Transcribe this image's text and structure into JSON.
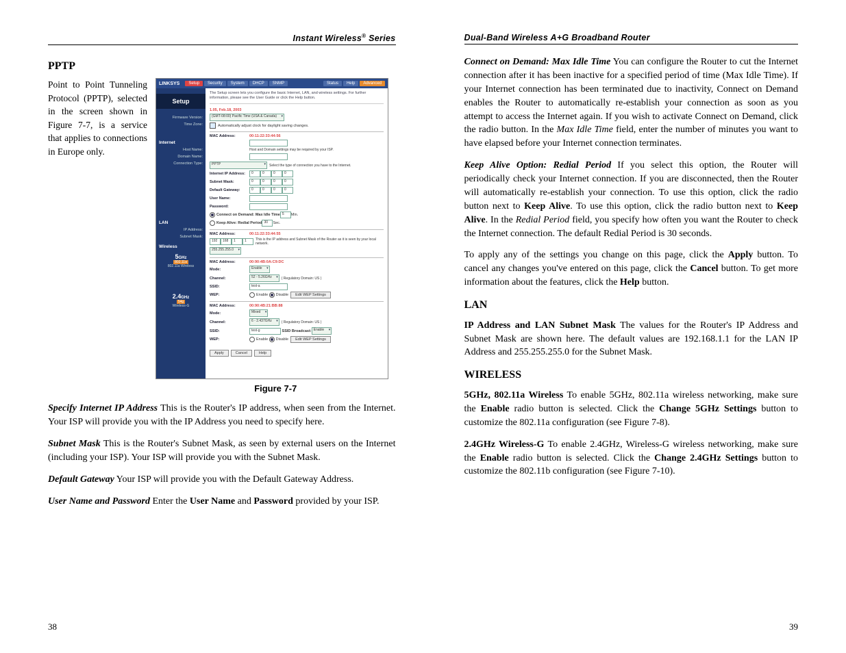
{
  "left": {
    "header": "Instant Wireless® Series",
    "section_title": "PPTP",
    "intro": "Point to Point Tunneling Protocol (PPTP), selected in the screen shown in Figure 7-7, is a service that applies to connections in Europe only.",
    "figure_caption": "Figure 7-7",
    "para_specify_label": "Specify Internet IP Address",
    "para_specify": "  This is the Router's IP address, when seen from the Internet. Your ISP will provide you with the IP Address you need to specify here.",
    "para_subnet_label": "Subnet Mask",
    "para_subnet": "  This is the Router's Subnet Mask, as seen by external users on the Internet (including your ISP). Your ISP will provide you with the Subnet Mask.",
    "para_gateway_label": "Default Gateway",
    "para_gateway": "  Your ISP will provide you with the Default Gateway Address.",
    "para_userpass_label": "User Name and Password",
    "para_userpass_a": "  Enter the ",
    "para_userpass_b": "User Name",
    "para_userpass_c": " and ",
    "para_userpass_d": "Password",
    "para_userpass_e": " provided by your ISP.",
    "page_num": "38"
  },
  "right": {
    "header": "Dual-Band Wireless A+G Broadband Router",
    "p1_label": "Connect on Demand: Max Idle Time",
    "p1_a": "  You can configure the Router to cut the Internet connection after it has been inactive for a specified period of time (Max Idle Time). If your Internet connection has been terminated due to inactivity, Connect on Demand enables the Router to automatically re-establish your connection as soon as you attempt to access the Internet again. If you wish to activate Connect on Demand, click the radio button. In the ",
    "p1_b": "Max Idle Time",
    "p1_c": " field, enter the number of minutes you want to have elapsed before your Internet connection terminates.",
    "p2_label": "Keep Alive Option: Redial Period",
    "p2_a": " If you select this option, the Router will periodically check your Internet connection. If you are disconnected, then the Router will automatically re-establish your connection. To use this option, click the radio button next to ",
    "p2_b": "Keep Alive",
    "p2_c": ". To use this option, click the radio button next to ",
    "p2_d": "Keep Alive",
    "p2_e": ". In the ",
    "p2_f": "Redial Period",
    "p2_g": " field, you specify how often you want the Router to check the Internet connection. The default Redial Period is 30 seconds.",
    "p3_a": "To apply any of the settings you change on this page, click the ",
    "p3_b": "Apply",
    "p3_c": " button. To cancel any changes you've entered on this page, click the ",
    "p3_d": "Cancel",
    "p3_e": " button. To get more information about the features, click the ",
    "p3_f": "Help",
    "p3_g": " button.",
    "lan_title": "LAN",
    "lan_label": "IP Address and LAN Subnet Mask",
    "lan_text": "  The values for the Router's IP Address and Subnet Mask are shown here. The default values are 192.168.1.1 for the LAN IP Address and 255.255.255.0 for the Subnet Mask.",
    "wireless_title": "WIRELESS",
    "w5_label": "5GHz, 802.11a Wireless",
    "w5_a": "  To enable 5GHz, 802.11a wireless networking, make sure the ",
    "w5_b": "Enable",
    "w5_c": " radio button is selected. Click the ",
    "w5_d": "Change 5GHz Settings",
    "w5_e": " button to customize the 802.11a configuration (see Figure 7-8).",
    "w24_label": "2.4GHz Wireless-G",
    "w24_a": "  To enable 2.4GHz, Wireless-G wireless networking, make sure the ",
    "w24_b": "Enable",
    "w24_c": " radio button is selected. Click the ",
    "w24_d": "Change 2.4GHz Settings",
    "w24_e": " button to customize the 802.11b configuration (see Figure 7-10).",
    "page_num": "39"
  },
  "router": {
    "logo": "LINKSYS",
    "tabs": [
      "Setup",
      "Security",
      "System",
      "DHCP",
      "SNMP"
    ],
    "right_tabs": [
      "Status",
      "Help",
      "Advanced"
    ],
    "setup": "Setup",
    "desc": "The Setup screen lets you configure the basic Internet, LAN, and wireless settings. For further information, please see the User Guide or click the Help button.",
    "fw_label": "Firmware Version:",
    "fw_val": "1.05, Feb.18, 2003",
    "tz_label": "Time Zone:",
    "tz_val": "(GMT-08:00) Pacific Time (USA & Canada)",
    "tz_auto": "Automatically adjust clock for daylight saving changes.",
    "internet_title": "Internet",
    "mac1_label": "MAC Address:",
    "mac1_val": "00:11:22:33:44:56",
    "host_label": "Host Name:",
    "domain_label": "Domain Name:",
    "hostnote": "Host and Domain settings may be required by your ISP.",
    "conn_label": "Connection Type:",
    "conn_val": "PPTP",
    "conn_note": "Select the type of connection you have to the Internet.",
    "iip_label": "Internet IP Address:",
    "sm_label": "Subnet Mask:",
    "dg_label": "Default Gateway:",
    "un_label": "User Name:",
    "pw_label": "Password:",
    "cod": "Connect on Demand: Max Idle Time",
    "cod_val": "5",
    "cod_unit": "Min.",
    "ka": "Keep Alive: Redial Period",
    "ka_val": "30",
    "ka_unit": "Sec.",
    "lan_title": "LAN",
    "mac2_label": "MAC Address:",
    "mac2_val": "00:11:22:33:44:55",
    "lanip_label": "IP Address:",
    "lanip": [
      "192",
      "168",
      "1",
      "1"
    ],
    "lanip_note": "This is the IP address and Subnet Mask of the Router as it is seen by your local network.",
    "lansm_label": "Subnet Mask:",
    "lansm_val": "255.255.255.0",
    "wireless_title": "Wireless",
    "w5_big": "5",
    "w5_ghz": "GHz",
    "w5_badge": "802.11a",
    "w5_sub": "802.11a Wireless",
    "mac3_val": "00:90:4B:0A:C9:DC",
    "mode_label": "Mode:",
    "mode5_val": "Enable",
    "ch_label": "Channel:",
    "ch5_val": "52 - 5.26GHz",
    "regdom": "( Regulatory Domain: US )",
    "ssid_label": "SSID:",
    "ssid5_val": "test-a",
    "wep_label": "WEP:",
    "enable": "Enable",
    "disable": "Disable",
    "wepbtn": "Edit WEP Settings",
    "w24_big": "2.4",
    "w24_ghz": "GHz",
    "w24_badge": "54g",
    "w24_sub": "Wireless-G",
    "mac4_val": "00:90:4B:21:BB:88",
    "mode24_val": "Mixed",
    "ch24_val": "6 - 2.437GHz",
    "ssid24_val": "test-g",
    "ssidb_label": "SSID Broadcast:",
    "ssidb_val": "Enable",
    "apply": "Apply",
    "cancel": "Cancel",
    "help": "Help"
  }
}
